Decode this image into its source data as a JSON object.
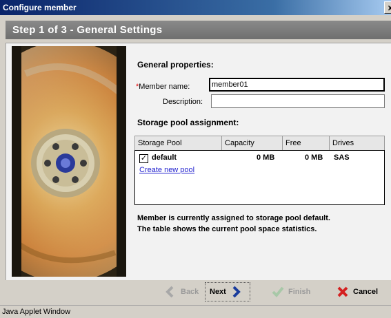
{
  "window": {
    "title": "Configure member",
    "close_label": "x"
  },
  "step": {
    "title": "Step 1 of 3 - General Settings"
  },
  "general": {
    "heading": "General properties:",
    "required_mark": "*",
    "member_name_label": "Member name:",
    "member_name_value": "member01",
    "description_label": "Description:",
    "description_value": ""
  },
  "storage": {
    "heading": "Storage pool assignment:",
    "columns": [
      "Storage Pool",
      "Capacity",
      "Free",
      "Drives"
    ],
    "rows": [
      {
        "checked": true,
        "checkmark": "✓",
        "pool": "default",
        "capacity": "0 MB",
        "free": "0 MB",
        "drives": "SAS"
      }
    ],
    "create_link": "Create new pool"
  },
  "notes": {
    "line1": "Member is currently assigned to storage pool default.",
    "line2": "The table shows the current pool space statistics."
  },
  "buttons": {
    "back": "Back",
    "next": "Next",
    "finish": "Finish",
    "cancel": "Cancel"
  },
  "icons": {
    "back": "chevron-left-icon",
    "next": "chevron-right-icon",
    "finish": "checkmark-icon",
    "cancel": "x-icon",
    "image": "disk-drive-platter-image"
  },
  "colors": {
    "title_bar": "#0a246a",
    "step_bar": "#7a7a7a",
    "link": "#1f1fce",
    "required": "#e00000",
    "cancel_x": "#d42020",
    "next_arrow": "#1a3c9c"
  },
  "status": {
    "text": "Java Applet Window"
  }
}
